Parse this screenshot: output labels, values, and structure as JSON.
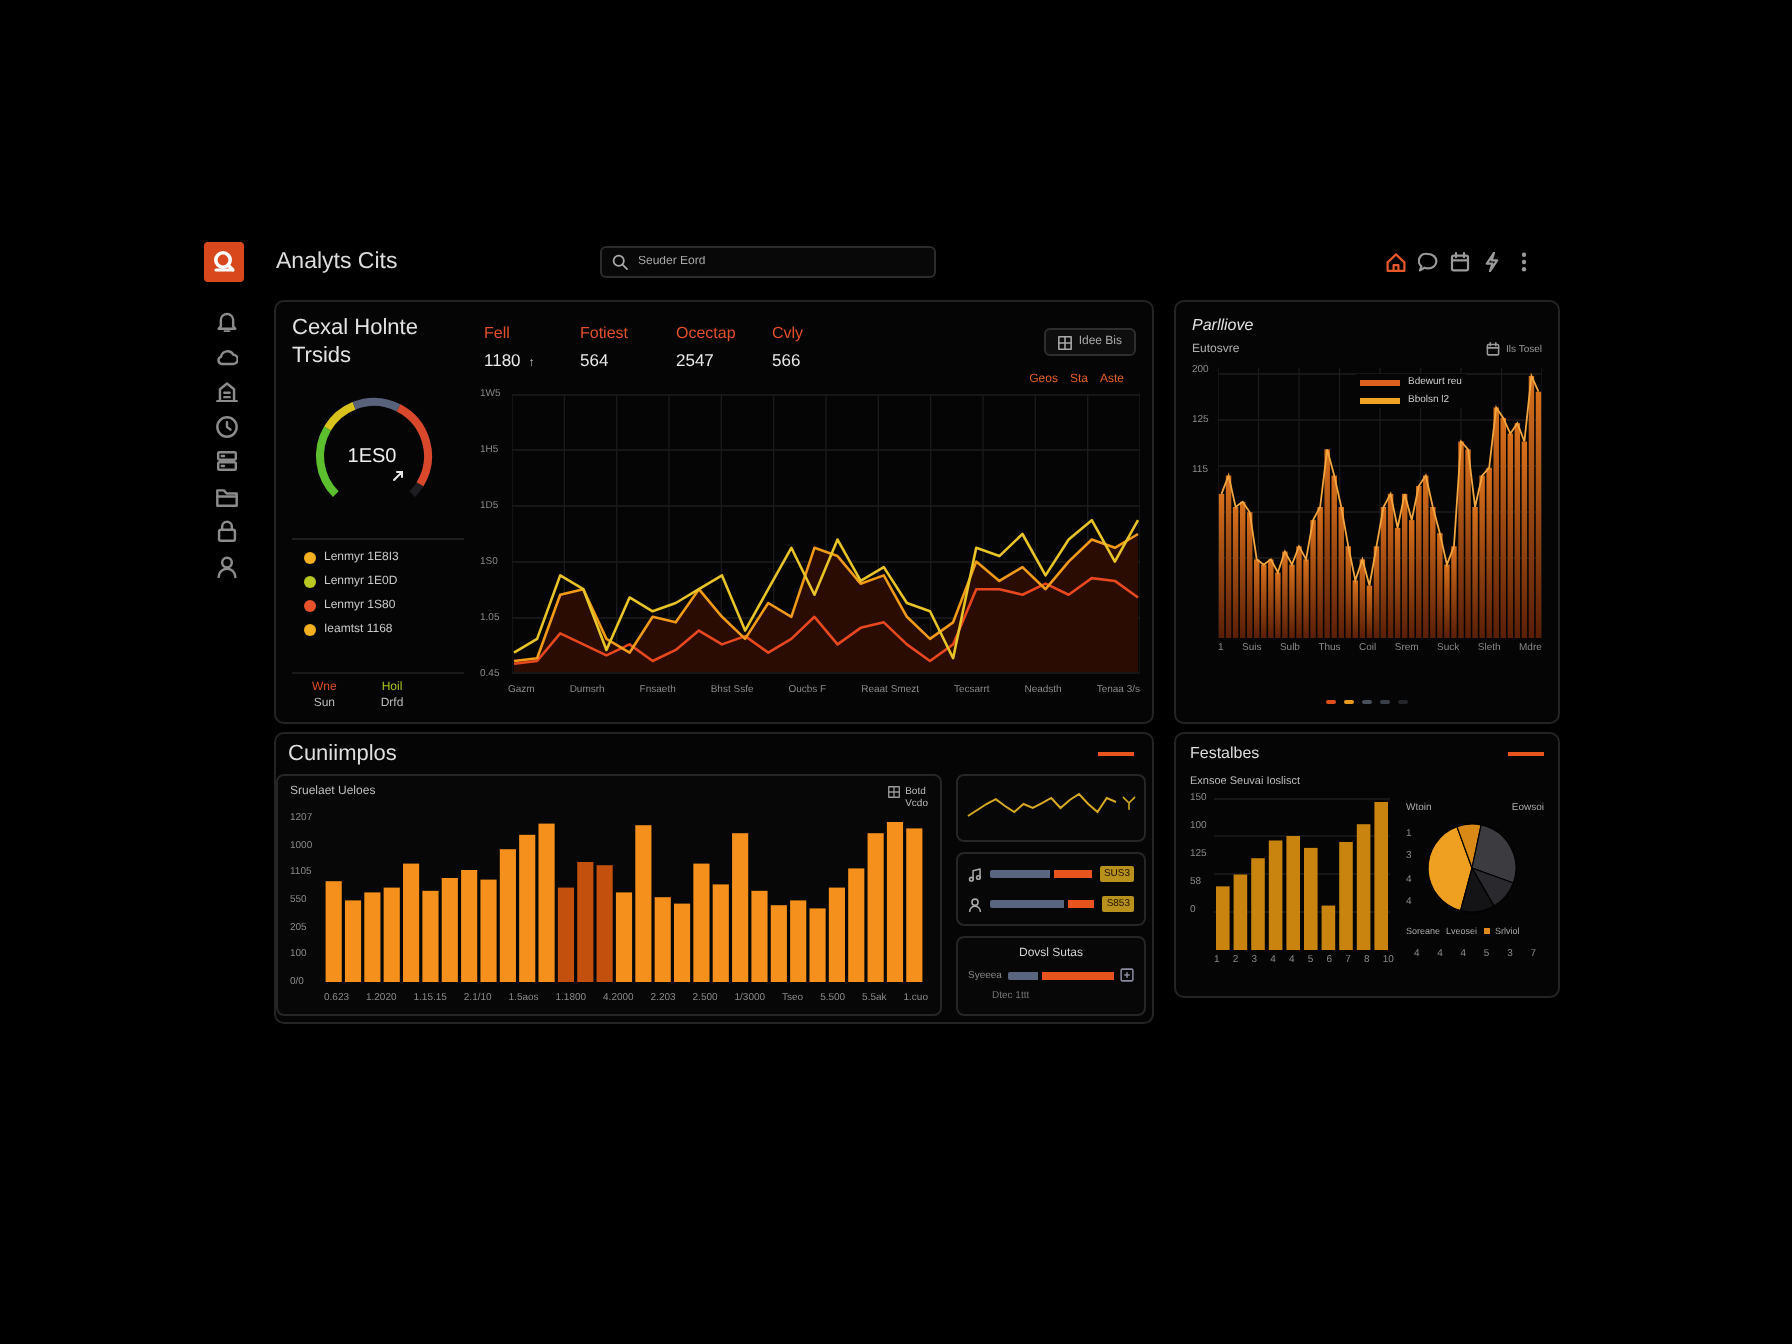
{
  "app": {
    "title": "Analyts Cits",
    "search": {
      "placeholder": "Seuder Eord"
    }
  },
  "toolbar": [
    {
      "kind": "home",
      "selected": true
    },
    {
      "kind": "chat",
      "selected": false
    },
    {
      "kind": "calendar",
      "selected": false
    },
    {
      "kind": "bolt",
      "selected": false
    },
    {
      "kind": "more",
      "selected": false
    }
  ],
  "sidebar": {
    "items": [
      {
        "kind": "bell",
        "selected": false
      },
      {
        "kind": "cloud",
        "selected": false
      },
      {
        "kind": "building",
        "selected": false
      },
      {
        "kind": "clock",
        "selected": false
      },
      {
        "kind": "server",
        "selected": false
      },
      {
        "kind": "folder",
        "selected": false
      },
      {
        "kind": "lock",
        "selected": false
      },
      {
        "kind": "user",
        "selected": false
      }
    ]
  },
  "overview": {
    "title": "Cexal Holnte Trsids",
    "gauge": {
      "value": "1ES0",
      "level": 0.95
    },
    "legend": [
      {
        "label": "Lenmyr 1E8I3",
        "color": "#f2b01e"
      },
      {
        "label": "Lenmyr 1E0D",
        "color": "#b8c820"
      },
      {
        "label": "Lenmyr 1S80",
        "color": "#e8522a"
      },
      {
        "label": "Ieamtst 1168",
        "color": "#f2b01e"
      }
    ],
    "stats": [
      {
        "label": "Wne",
        "value": "Sun",
        "color": "#d8502a"
      },
      {
        "label": "Hoil",
        "value": "Drfd",
        "color": "#a8c020"
      }
    ]
  },
  "kpis": [
    {
      "label": "Fell",
      "value": "1180",
      "note": "↑"
    },
    {
      "label": "Fotiest",
      "value": "564"
    },
    {
      "label": "Ocectap",
      "value": "2547"
    },
    {
      "label": "Cvly",
      "value": "566"
    }
  ],
  "trend_chart": {
    "button": "Idee Bis",
    "legend": [
      "Geos",
      "Sta",
      "Aste"
    ],
    "y_labels": [
      "1W5",
      "1H5",
      "1D5",
      "1S0",
      "1.05",
      "0.45"
    ],
    "x_labels": [
      "Gazm",
      "Dumsrh",
      "Fnsaeth",
      "Bhst Ssfe",
      "Oucbs F",
      "Reaat Smezt",
      "Tecsarrt",
      "Neadsth",
      "Tenaa 3/s"
    ]
  },
  "activity": {
    "title": "Parlliove",
    "subtitle": "Eutosvre",
    "control": "Ils Tosel",
    "legend": [
      {
        "label": "Bdewurt reu",
        "color": "#e0601e"
      },
      {
        "label": "Bbolsn l2",
        "color": "#f0a424"
      }
    ],
    "y_labels": [
      "200",
      "125",
      "115"
    ],
    "x_labels": [
      "1",
      "Suis",
      "Sulb",
      "Thus",
      "Coil",
      "Srem",
      "Suck",
      "Sleth",
      "Mdre"
    ],
    "page_dots": [
      {
        "color": "#e0501a"
      },
      {
        "color": "#e89a20"
      },
      {
        "color": "#4a4f5c"
      },
      {
        "color": "#3a3e48"
      },
      {
        "color": "#24262c"
      }
    ]
  },
  "contributions": {
    "title": "Cuniimplos",
    "chart": {
      "subtitle": "Sruelaet Ueloes",
      "legend": [
        "Botd",
        "Vcdo"
      ],
      "y_labels": [
        "1207",
        "1000",
        "1105",
        "550",
        "205",
        "100",
        "0/0"
      ],
      "x_labels": [
        "0.623",
        "1.2020",
        "1.15.15",
        "2.1/10",
        "1.5aos",
        "1.1800",
        "4.2000",
        "2.203",
        "2.500",
        "1/3000",
        "Tseo",
        "5.500",
        "5.5ak",
        "1.cuo"
      ]
    },
    "meters": [
      {
        "kind": "music",
        "level": 0.42,
        "badge": "SUS3"
      },
      {
        "kind": "user",
        "level": 0.3,
        "badge": "S853"
      }
    ],
    "status": {
      "title": "Dovsl Sutas",
      "label": "Syeeea",
      "level": 0.72,
      "note": "Dtec 1ttt"
    }
  },
  "features": {
    "title": "Festalbes",
    "chart": {
      "subtitle": "Exnsoe Seuvai Ioslisct",
      "y_labels": [
        "150",
        "100",
        "125",
        "58",
        "0"
      ],
      "x_labels": [
        "1",
        "2",
        "3",
        "4",
        "4",
        "5",
        "6",
        "7",
        "8",
        "10"
      ]
    },
    "pie": {
      "title": "Wtoin",
      "note": "Eowsoi",
      "y_labels": [
        "1",
        "3",
        "4",
        "4"
      ],
      "legend": [
        {
          "label": "Soreane"
        },
        {
          "label": "Lveosei"
        },
        {
          "label": "Srlviol",
          "color": "#e08a1a"
        }
      ],
      "x_labels": [
        "4",
        "4",
        "4",
        "5",
        "3",
        "7"
      ]
    }
  }
}
